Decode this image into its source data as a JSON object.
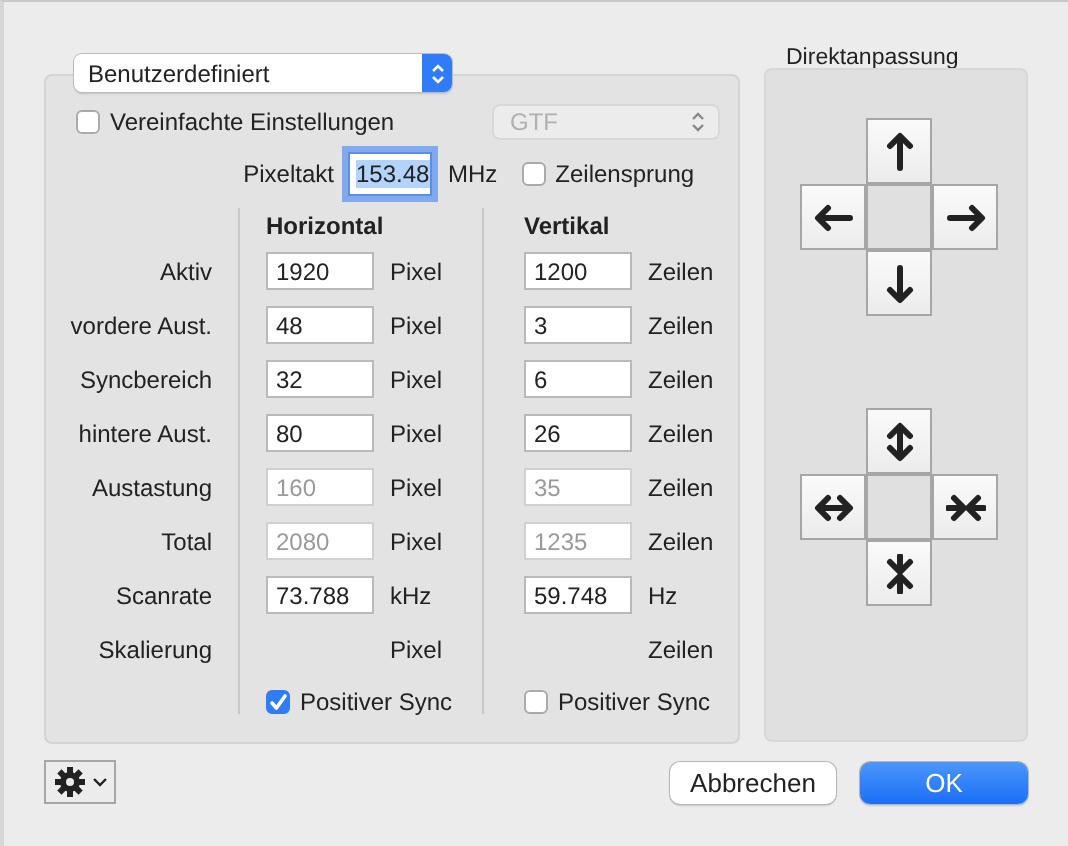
{
  "preset": {
    "value": "Benutzerdefiniert"
  },
  "simplified": {
    "label": "Vereinfachte Einstellungen",
    "checked": false
  },
  "timing_standard": {
    "value": "GTF",
    "disabled": true
  },
  "pixel_clock": {
    "label": "Pixeltakt",
    "value": "153.48",
    "unit": "MHz",
    "focused": true
  },
  "interlaced": {
    "label": "Zeilensprung",
    "checked": false
  },
  "columns": [
    {
      "heading": "Horizontal"
    },
    {
      "heading": "Vertikal"
    }
  ],
  "rows": [
    {
      "label": "Aktiv",
      "horizontal": {
        "value": "1920",
        "unit": "Pixel",
        "disabled": false
      },
      "vertical": {
        "value": "1200",
        "unit": "Zeilen",
        "disabled": false
      }
    },
    {
      "label": "vordere Aust.",
      "horizontal": {
        "value": "48",
        "unit": "Pixel",
        "disabled": false
      },
      "vertical": {
        "value": "3",
        "unit": "Zeilen",
        "disabled": false
      }
    },
    {
      "label": "Syncbereich",
      "horizontal": {
        "value": "32",
        "unit": "Pixel",
        "disabled": false
      },
      "vertical": {
        "value": "6",
        "unit": "Zeilen",
        "disabled": false
      }
    },
    {
      "label": "hintere Aust.",
      "horizontal": {
        "value": "80",
        "unit": "Pixel",
        "disabled": false
      },
      "vertical": {
        "value": "26",
        "unit": "Zeilen",
        "disabled": false
      }
    },
    {
      "label": "Austastung",
      "horizontal": {
        "value": "160",
        "unit": "Pixel",
        "disabled": true
      },
      "vertical": {
        "value": "35",
        "unit": "Zeilen",
        "disabled": true
      }
    },
    {
      "label": "Total",
      "horizontal": {
        "value": "2080",
        "unit": "Pixel",
        "disabled": true
      },
      "vertical": {
        "value": "1235",
        "unit": "Zeilen",
        "disabled": true
      }
    },
    {
      "label": "Scanrate",
      "horizontal": {
        "value": "73.788",
        "unit": "kHz",
        "disabled": false
      },
      "vertical": {
        "value": "59.748",
        "unit": "Hz",
        "disabled": false
      }
    },
    {
      "label": "Skalierung",
      "horizontal": {
        "unit": "Pixel"
      },
      "vertical": {
        "unit": "Zeilen"
      }
    }
  ],
  "sync": [
    {
      "label": "Positiver Sync",
      "checked": true
    },
    {
      "label": "Positiver Sync",
      "checked": false
    }
  ],
  "adjust": {
    "title": "Direktanpassung",
    "pads": [
      {
        "kind": "move"
      },
      {
        "kind": "resize"
      }
    ]
  },
  "buttons": [
    {
      "label": "Abbrechen",
      "kind": "cancel"
    },
    {
      "label": "OK",
      "kind": "default"
    }
  ]
}
